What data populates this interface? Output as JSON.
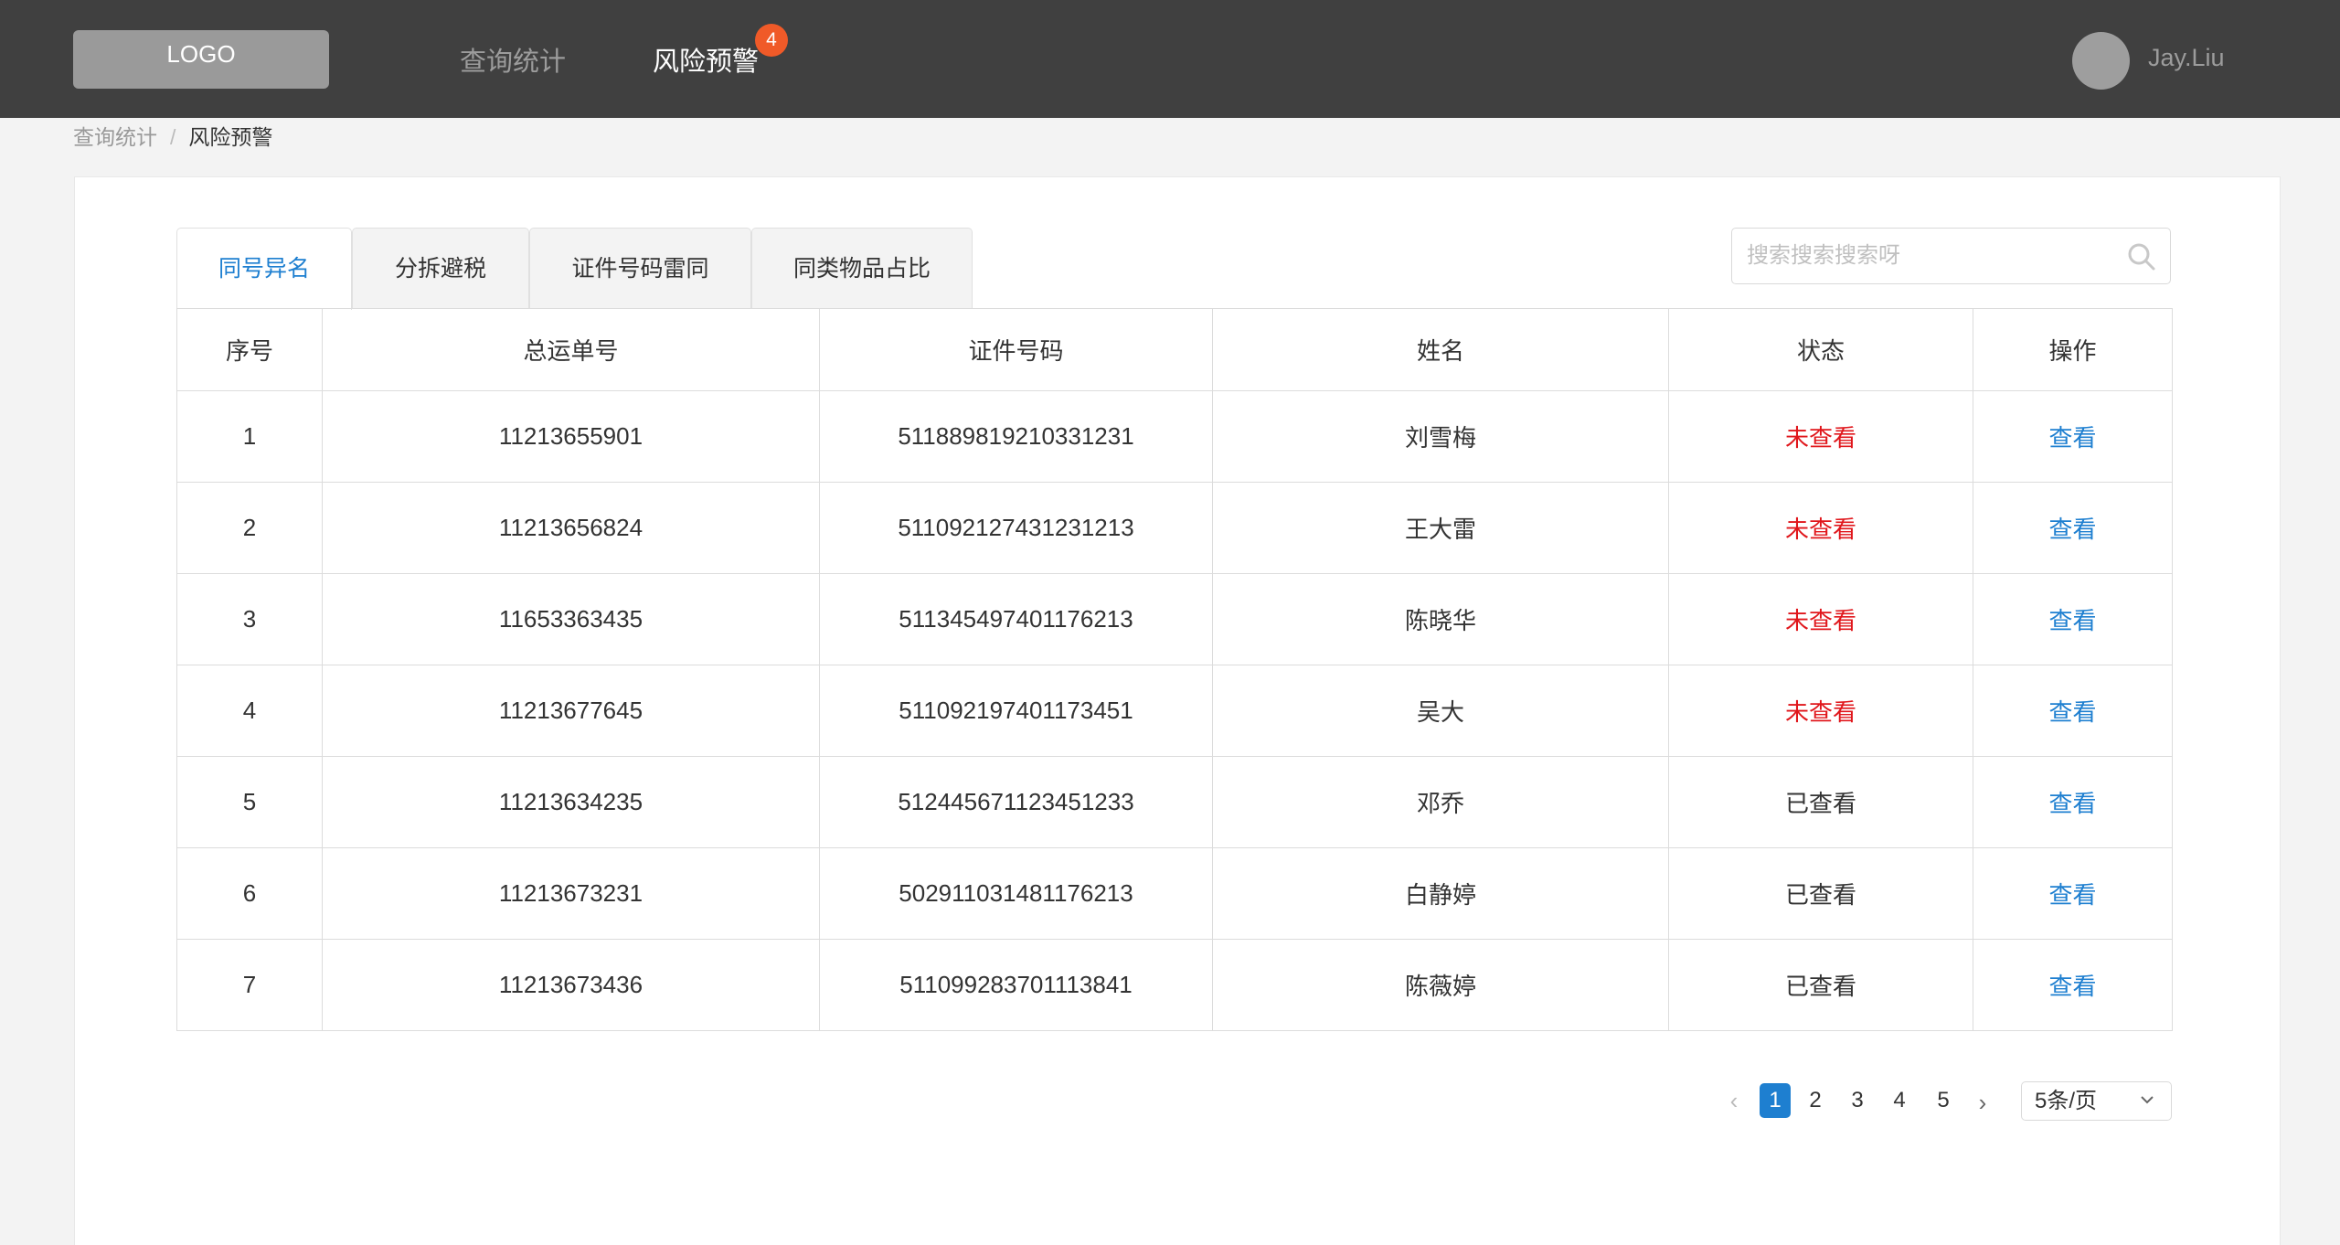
{
  "header": {
    "logo": "LOGO",
    "nav": [
      {
        "label": "查询统计"
      },
      {
        "label": "风险预警"
      }
    ],
    "badge_count": "4",
    "username": "Jay.Liu"
  },
  "breadcrumb": {
    "items": [
      "查询统计",
      "风险预警"
    ],
    "separator": "/"
  },
  "tabs": [
    {
      "label": "同号异名"
    },
    {
      "label": "分拆避税"
    },
    {
      "label": "证件号码雷同"
    },
    {
      "label": "同类物品占比"
    }
  ],
  "search": {
    "placeholder": "搜索搜索搜索呀",
    "value": ""
  },
  "table": {
    "headers": [
      "序号",
      "总运单号",
      "证件号码",
      "姓名",
      "状态",
      "操作"
    ],
    "rows": [
      {
        "idx": "1",
        "waybill": "11213655901",
        "id_no": "511889819210331231",
        "name": "刘雪梅",
        "status": "未查看",
        "action": "查看"
      },
      {
        "idx": "2",
        "waybill": "11213656824",
        "id_no": "511092127431231213",
        "name": "王大雷",
        "status": "未查看",
        "action": "查看"
      },
      {
        "idx": "3",
        "waybill": "11653363435",
        "id_no": "511345497401176213",
        "name": "陈晓华",
        "status": "未查看",
        "action": "查看"
      },
      {
        "idx": "4",
        "waybill": "11213677645",
        "id_no": "511092197401173451",
        "name": "吴大",
        "status": "未查看",
        "action": "查看"
      },
      {
        "idx": "5",
        "waybill": "11213634235",
        "id_no": "512445671123451233",
        "name": "邓乔",
        "status": "已查看",
        "action": "查看"
      },
      {
        "idx": "6",
        "waybill": "11213673231",
        "id_no": "502911031481176213",
        "name": "白静婷",
        "status": "已查看",
        "action": "查看"
      },
      {
        "idx": "7",
        "waybill": "11213673436",
        "id_no": "511099283701113841",
        "name": "陈薇婷",
        "status": "已查看",
        "action": "查看"
      }
    ]
  },
  "pagination": {
    "pages": [
      "1",
      "2",
      "3",
      "4",
      "5"
    ],
    "current": "1",
    "prev": "‹",
    "next": "›",
    "page_size": "5条/页"
  },
  "colors": {
    "topbar": "#404040",
    "accent": "#1e7fd0",
    "badge": "#f05a28",
    "unread": "#e0161b"
  }
}
